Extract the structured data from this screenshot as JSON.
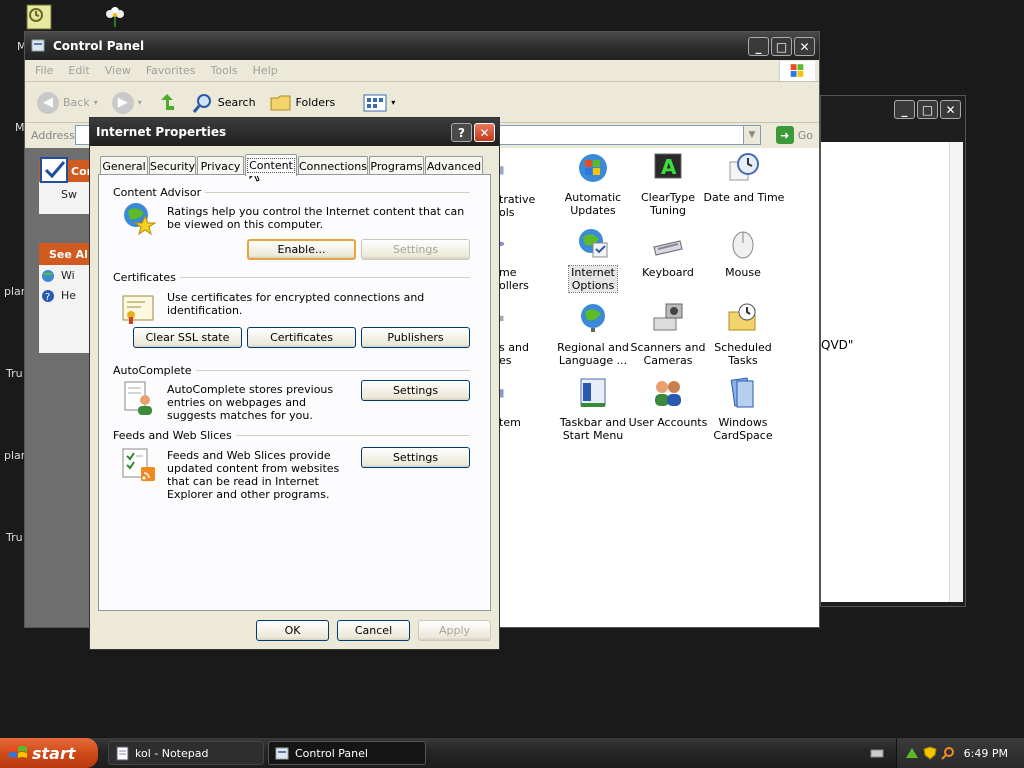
{
  "desktop": {
    "fragments": [
      "M",
      "M",
      "plar",
      "Tru",
      "plar",
      "Tru"
    ]
  },
  "control_panel": {
    "title": "Control Panel",
    "menu": [
      "File",
      "Edit",
      "View",
      "Favorites",
      "Tools",
      "Help"
    ],
    "toolbar": {
      "back": "Back",
      "search": "Search",
      "folders": "Folders"
    },
    "address_label": "Address",
    "go_label": "Go",
    "left_pane": {
      "box1_head": "Con",
      "box1_item": "Sw",
      "box2_head": "See Al",
      "box2_items": [
        "Wi",
        "He"
      ]
    },
    "items": [
      {
        "label": "trative\nols"
      },
      {
        "label": "Automatic\nUpdates"
      },
      {
        "label": "ClearType\nTuning"
      },
      {
        "label": "Date and Time"
      },
      {
        "label": "me\nollers"
      },
      {
        "label": "Internet\nOptions"
      },
      {
        "label": "Keyboard"
      },
      {
        "label": "Mouse"
      },
      {
        "label": "s and\nes"
      },
      {
        "label": "Regional and\nLanguage ..."
      },
      {
        "label": "Scanners and\nCameras"
      },
      {
        "label": "Scheduled\nTasks"
      },
      {
        "label": "tem"
      },
      {
        "label": "Taskbar and\nStart Menu"
      },
      {
        "label": "User Accounts"
      },
      {
        "label": "Windows\nCardSpace"
      }
    ]
  },
  "background_window": {
    "text": "QVD\""
  },
  "internet_properties": {
    "title": "Internet Properties",
    "tabs": [
      "General",
      "Security",
      "Privacy",
      "Content",
      "Connections",
      "Programs",
      "Advanced"
    ],
    "content_advisor": {
      "label": "Content Advisor",
      "text": "Ratings help you control the Internet content that can be viewed on this computer.",
      "enable": "Enable...",
      "settings": "Settings"
    },
    "certificates": {
      "label": "Certificates",
      "text": "Use certificates for encrypted connections and identification.",
      "clear_ssl": "Clear SSL state",
      "certificates_btn": "Certificates",
      "publishers": "Publishers"
    },
    "autocomplete": {
      "label": "AutoComplete",
      "text": "AutoComplete stores previous entries on webpages and suggests matches for you.",
      "settings": "Settings"
    },
    "feeds": {
      "label": "Feeds and Web Slices",
      "text": "Feeds and Web Slices provide updated content from websites that can be read in Internet Explorer and other programs.",
      "settings": "Settings"
    },
    "ok": "OK",
    "cancel": "Cancel",
    "apply": "Apply"
  },
  "taskbar": {
    "start": "start",
    "tasks": [
      "kol - Notepad",
      "Control Panel"
    ],
    "clock": "6:49 PM"
  }
}
